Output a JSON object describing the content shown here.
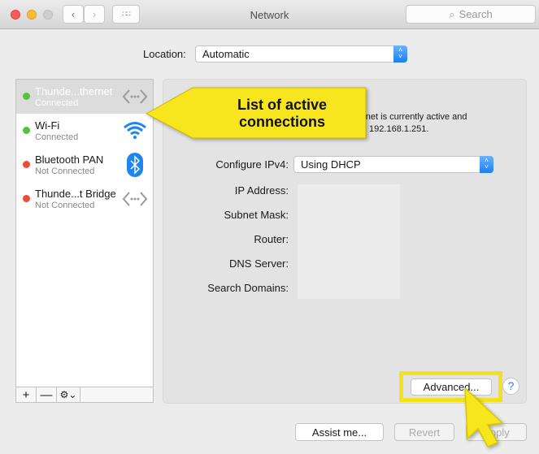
{
  "window": {
    "title": "Network",
    "search_placeholder": "Search"
  },
  "location": {
    "label": "Location:",
    "value": "Automatic"
  },
  "connections": [
    {
      "name": "Thunde...thernet",
      "status": "Connected",
      "state_color": "#5ac03f",
      "icon": "ethernet-icon",
      "selected": true
    },
    {
      "name": "Wi-Fi",
      "status": "Connected",
      "state_color": "#5ac03f",
      "icon": "wifi-icon",
      "selected": false
    },
    {
      "name": "Bluetooth PAN",
      "status": "Not Connected",
      "state_color": "#ee4b3f",
      "icon": "bluetooth-icon",
      "selected": false
    },
    {
      "name": "Thunde...t Bridge",
      "status": "Not Connected",
      "state_color": "#ee4b3f",
      "icon": "ethernet-icon",
      "selected": false
    }
  ],
  "list_toolbar": {
    "add": "+",
    "remove": "—"
  },
  "status": {
    "line1": "ernet is currently active and",
    "line2": "ss 192.168.1.251."
  },
  "configure": {
    "label": "Configure IPv4:",
    "value": "Using DHCP"
  },
  "fields": [
    "IP Address:",
    "Subnet Mask:",
    "Router:",
    "DNS Server:",
    "Search Domains:"
  ],
  "buttons": {
    "advanced": "Advanced...",
    "help": "?",
    "assist": "Assist me...",
    "revert": "Revert",
    "apply": "Apply"
  },
  "annotation": {
    "callout": "List of active connections",
    "color": "#f7e51e"
  }
}
